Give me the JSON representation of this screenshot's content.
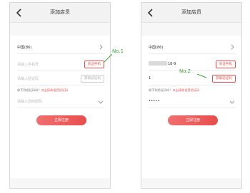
{
  "left": {
    "title": "添加店员",
    "region": "中国(86)",
    "phone_placeholder": "请输入手机号",
    "verify_button": "验证手机",
    "code_placeholder": "请输入验证码",
    "get_code_button": "获取验证码",
    "hint_text": "收不到验证码吗？",
    "hint_link": "点击接收语音验证码",
    "password_placeholder": "请输入您的密码",
    "submit_button": "立即注册"
  },
  "right": {
    "title": "添加店员",
    "region": "中国(86)",
    "phone_suffix": "18-9",
    "verify_button": "验证手机",
    "code_value": "1",
    "get_code_button": "获取验证码",
    "hint_text": "收不到验证码吗？",
    "hint_link": "点击接收语音验证码",
    "password_value": "•••••",
    "submit_button": "立即注册"
  },
  "annotations": {
    "label_1": "No.1",
    "label_2": "No.2"
  },
  "colors": {
    "accent": "#e84d4d",
    "annotation": "#3aa83a"
  },
  "icons": {
    "back": "chevron-left-icon",
    "region": "chevron-right-icon",
    "password_toggle": "chevron-down-icon"
  }
}
